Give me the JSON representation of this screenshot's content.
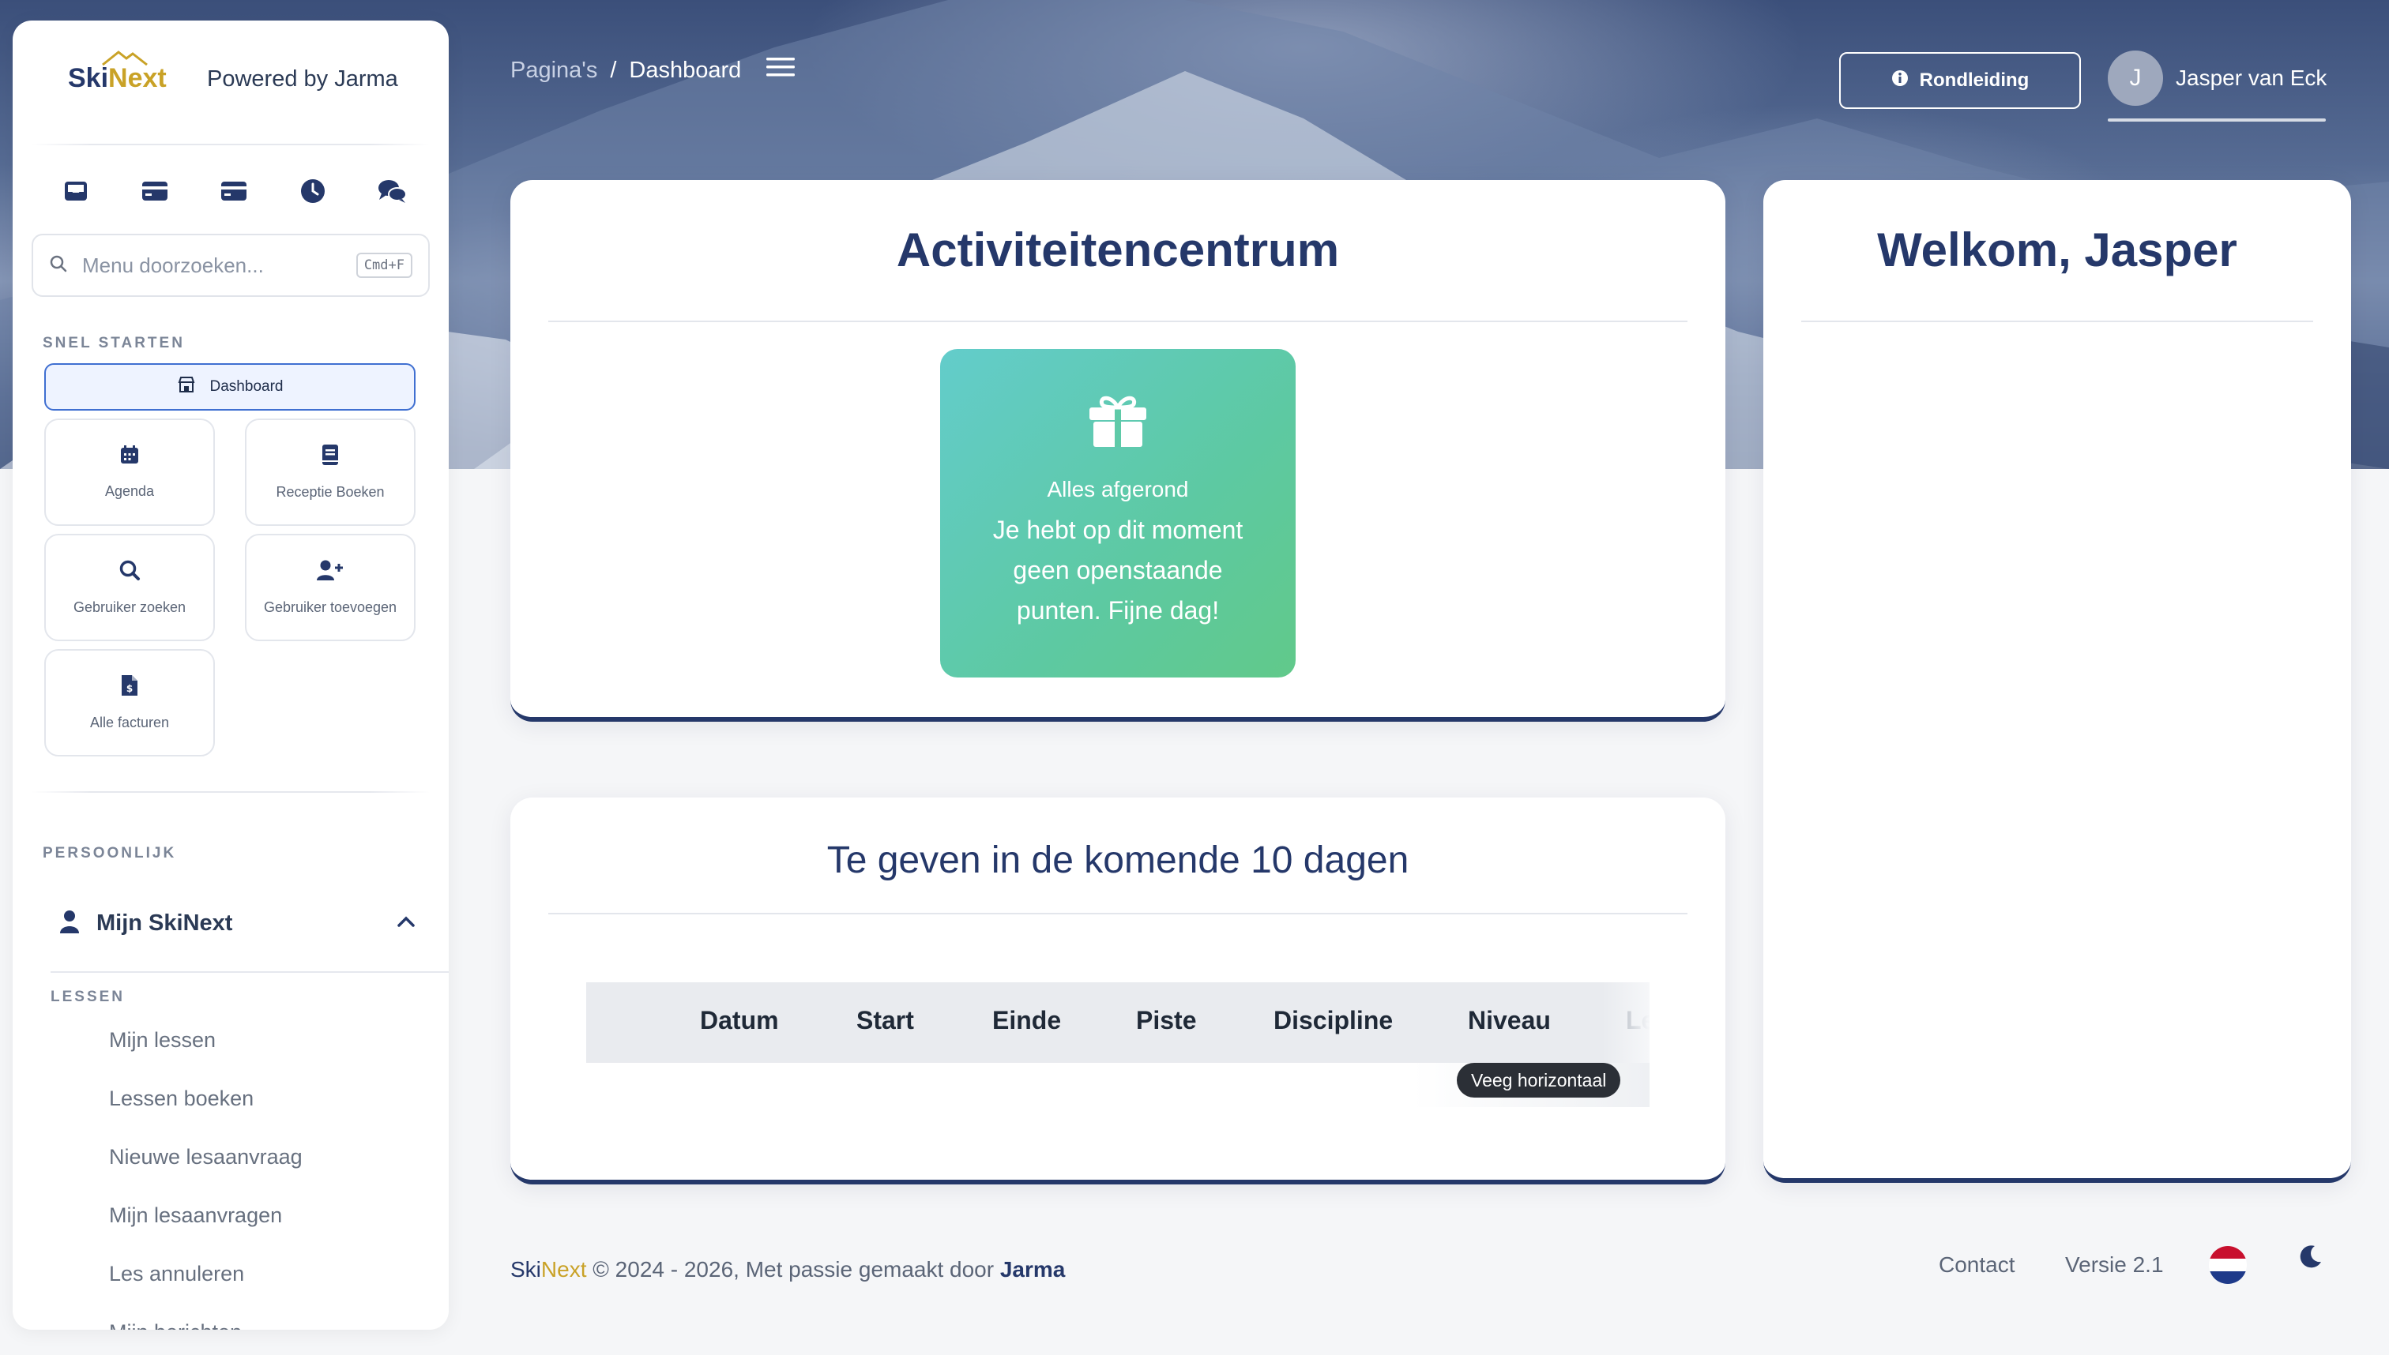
{
  "app": {
    "brand_ski": "Ski",
    "brand_next": "Next",
    "powered_by": "Powered by Jarma"
  },
  "colors": {
    "navy": "#25386a",
    "gold": "#c9a227",
    "accent_blue": "#3f6fd1",
    "teal_gradient_start": "#63cccb",
    "teal_gradient_end": "#61c98a"
  },
  "sidebar": {
    "quick_icons": [
      "inbox-icon",
      "credit-card-icon",
      "credit-card-icon",
      "clock-icon",
      "chat-icon"
    ],
    "search": {
      "placeholder": "Menu doorzoeken...",
      "shortcut": "Cmd+F"
    },
    "quick_start": {
      "label": "SNEL STARTEN",
      "dashboard": "Dashboard",
      "tiles": [
        {
          "label": "Agenda",
          "icon": "calendar-icon"
        },
        {
          "label": "Receptie Boeken",
          "icon": "book-icon"
        },
        {
          "label": "Gebruiker zoeken",
          "icon": "search-icon"
        },
        {
          "label": "Gebruiker toevoegen",
          "icon": "user-plus-icon"
        },
        {
          "label": "Alle facturen",
          "icon": "invoice-icon"
        }
      ]
    },
    "personal": {
      "label": "PERSOONLIJK",
      "parent": "Mijn SkiNext",
      "sub_label": "LESSEN",
      "links": [
        "Mijn lessen",
        "Lessen boeken",
        "Nieuwe lesaanvraag",
        "Mijn lesaanvragen",
        "Les annuleren",
        "Mijn berichten"
      ]
    }
  },
  "header": {
    "breadcrumb": [
      "Pagina's",
      "Dashboard"
    ],
    "separator": "/",
    "tour_button": "Rondleiding",
    "user": {
      "initial": "J",
      "name": "Jasper van Eck"
    }
  },
  "activity": {
    "title": "Activiteitencentrum",
    "status": "Alles afgerond",
    "message": "Je hebt op dit moment geen openstaande punten. Fijne dag!"
  },
  "welcome": {
    "title": "Welkom, Jasper"
  },
  "upcoming": {
    "title": "Te geven in de komende 10 dagen",
    "columns": [
      "Datum",
      "Start",
      "Einde",
      "Piste",
      "Discipline",
      "Niveau",
      "Le"
    ],
    "swipe_hint": "Veeg horizontaal"
  },
  "footer": {
    "ski": "Ski",
    "next": "Next",
    "copyright": " © 2024 - 2026, Met passie gemaakt door ",
    "author": "Jarma",
    "contact": "Contact",
    "version": "Versie 2.1"
  }
}
